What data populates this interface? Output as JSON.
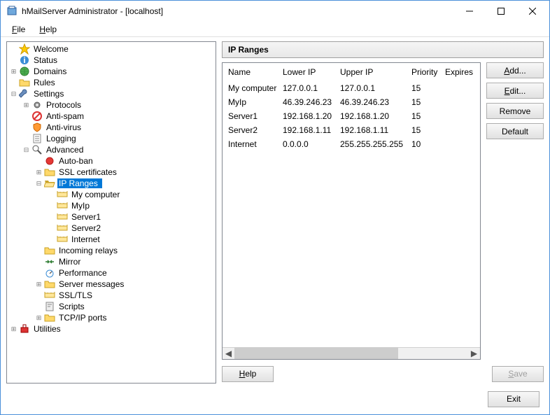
{
  "window": {
    "title": "hMailServer Administrator - [localhost]"
  },
  "menu": {
    "file": "File",
    "help": "Help"
  },
  "tree": [
    {
      "d": 0,
      "exp": "",
      "icon": "star",
      "label": "Welcome"
    },
    {
      "d": 0,
      "exp": "",
      "icon": "info",
      "label": "Status"
    },
    {
      "d": 0,
      "exp": "+",
      "icon": "globe",
      "label": "Domains"
    },
    {
      "d": 0,
      "exp": "",
      "icon": "folder",
      "label": "Rules"
    },
    {
      "d": 0,
      "exp": "-",
      "icon": "wrench",
      "label": "Settings"
    },
    {
      "d": 1,
      "exp": "+",
      "icon": "gear",
      "label": "Protocols"
    },
    {
      "d": 1,
      "exp": "",
      "icon": "nospam",
      "label": "Anti-spam"
    },
    {
      "d": 1,
      "exp": "",
      "icon": "shield",
      "label": "Anti-virus"
    },
    {
      "d": 1,
      "exp": "",
      "icon": "log",
      "label": "Logging"
    },
    {
      "d": 1,
      "exp": "-",
      "icon": "mag",
      "label": "Advanced"
    },
    {
      "d": 2,
      "exp": "",
      "icon": "red",
      "label": "Auto-ban"
    },
    {
      "d": 2,
      "exp": "+",
      "icon": "folder",
      "label": "SSL certificates"
    },
    {
      "d": 2,
      "exp": "-",
      "icon": "folderopen",
      "label": "IP Ranges",
      "sel": true
    },
    {
      "d": 3,
      "exp": "",
      "icon": "range",
      "label": "My computer"
    },
    {
      "d": 3,
      "exp": "",
      "icon": "range",
      "label": "MyIp"
    },
    {
      "d": 3,
      "exp": "",
      "icon": "range",
      "label": "Server1"
    },
    {
      "d": 3,
      "exp": "",
      "icon": "range",
      "label": "Server2"
    },
    {
      "d": 3,
      "exp": "",
      "icon": "range",
      "label": "Internet"
    },
    {
      "d": 2,
      "exp": "",
      "icon": "folder",
      "label": "Incoming relays"
    },
    {
      "d": 2,
      "exp": "",
      "icon": "mirror",
      "label": "Mirror"
    },
    {
      "d": 2,
      "exp": "",
      "icon": "perf",
      "label": "Performance"
    },
    {
      "d": 2,
      "exp": "+",
      "icon": "folder",
      "label": "Server messages"
    },
    {
      "d": 2,
      "exp": "",
      "icon": "range",
      "label": "SSL/TLS"
    },
    {
      "d": 2,
      "exp": "",
      "icon": "script",
      "label": "Scripts"
    },
    {
      "d": 2,
      "exp": "+",
      "icon": "folder",
      "label": "TCP/IP ports"
    },
    {
      "d": 0,
      "exp": "+",
      "icon": "util",
      "label": "Utilities"
    }
  ],
  "panel": {
    "title": "IP Ranges"
  },
  "columns": {
    "name": "Name",
    "lowerip": "Lower IP",
    "upperip": "Upper IP",
    "priority": "Priority",
    "expires": "Expires"
  },
  "rows": [
    {
      "name": "My computer",
      "lowerip": "127.0.0.1",
      "upperip": "127.0.0.1",
      "priority": "15",
      "expires": ""
    },
    {
      "name": "MyIp",
      "lowerip": "46.39.246.23",
      "upperip": "46.39.246.23",
      "priority": "15",
      "expires": ""
    },
    {
      "name": "Server1",
      "lowerip": "192.168.1.20",
      "upperip": "192.168.1.20",
      "priority": "15",
      "expires": ""
    },
    {
      "name": "Server2",
      "lowerip": "192.168.1.11",
      "upperip": "192.168.1.11",
      "priority": "15",
      "expires": ""
    },
    {
      "name": "Internet",
      "lowerip": "0.0.0.0",
      "upperip": "255.255.255.255",
      "priority": "10",
      "expires": ""
    }
  ],
  "buttons": {
    "add": "Add...",
    "edit": "Edit...",
    "remove": "Remove",
    "default": "Default",
    "help": "Help",
    "save": "Save",
    "exit": "Exit"
  }
}
